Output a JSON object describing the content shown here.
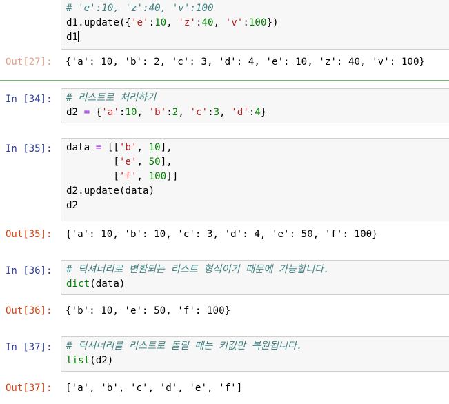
{
  "cells": {
    "c27": {
      "in_lines": {
        "l1": "# 'e':10, 'z':40, 'v':100",
        "l2_a": "d1.update({",
        "l2_s1": "'e'",
        "l2_b": ":",
        "l2_n1": "10",
        "l2_c": ", ",
        "l2_s2": "'z'",
        "l2_d": ":",
        "l2_n2": "40",
        "l2_e": ", ",
        "l2_s3": "'v'",
        "l2_f": ":",
        "l2_n3": "100",
        "l2_g": "})",
        "l3": "d1"
      },
      "out_prompt": "Out[27]:",
      "out_text": "{'a': 10, 'b': 2, 'c': 3, 'd': 4, 'e': 10, 'z': 40, 'v': 100}"
    },
    "c34": {
      "in_prompt": "In [34]:",
      "comment": "# 리스트로 처리하기",
      "l2_a": "d2 ",
      "l2_op": "=",
      "l2_b": " {",
      "l2_s1": "'a'",
      "l2_c": ":",
      "l2_n1": "10",
      "l2_d": ", ",
      "l2_s2": "'b'",
      "l2_e": ":",
      "l2_n2": "2",
      "l2_f": ", ",
      "l2_s3": "'c'",
      "l2_g": ":",
      "l2_n3": "3",
      "l2_h": ", ",
      "l2_s4": "'d'",
      "l2_i": ":",
      "l2_n4": "4",
      "l2_j": "}"
    },
    "c35": {
      "in_prompt": "In [35]:",
      "l1_a": "data ",
      "l1_op": "=",
      "l1_b": " [[",
      "l1_s": "'b'",
      "l1_c": ", ",
      "l1_n": "10",
      "l1_d": "],",
      "l2_a": "        [",
      "l2_s": "'e'",
      "l2_c": ", ",
      "l2_n": "50",
      "l2_d": "],",
      "l3_a": "        [",
      "l3_s": "'f'",
      "l3_c": ", ",
      "l3_n": "100",
      "l3_d": "]]",
      "l4": "d2.update(data)",
      "l5": "d2",
      "out_prompt": "Out[35]:",
      "out_text": "{'a': 10, 'b': 10, 'c': 3, 'd': 4, 'e': 50, 'f': 100}"
    },
    "c36": {
      "in_prompt": "In [36]:",
      "comment": "# 딕셔너리로 변환되는 리스트 형식이기 때문에 가능합니다.",
      "l2_fn": "dict",
      "l2_rest": "(data)",
      "out_prompt": "Out[36]:",
      "out_text": "{'b': 10, 'e': 50, 'f': 100}"
    },
    "c37": {
      "in_prompt": "In [37]:",
      "comment": "# 딕셔너리를 리스트로 돌릴 때는 키값만 복원됩니다.",
      "l2_fn": "list",
      "l2_rest": "(d2)",
      "out_prompt": "Out[37]:",
      "out_text": "['a', 'b', 'c', 'd', 'e', 'f']"
    }
  },
  "colors": {
    "comment": "#408080",
    "string": "#ba2121",
    "number": "#008000",
    "operator": "#aa22ff",
    "in_prompt": "#303f9f",
    "out_prompt": "#d84315",
    "selected_border": "#66bb6a"
  }
}
